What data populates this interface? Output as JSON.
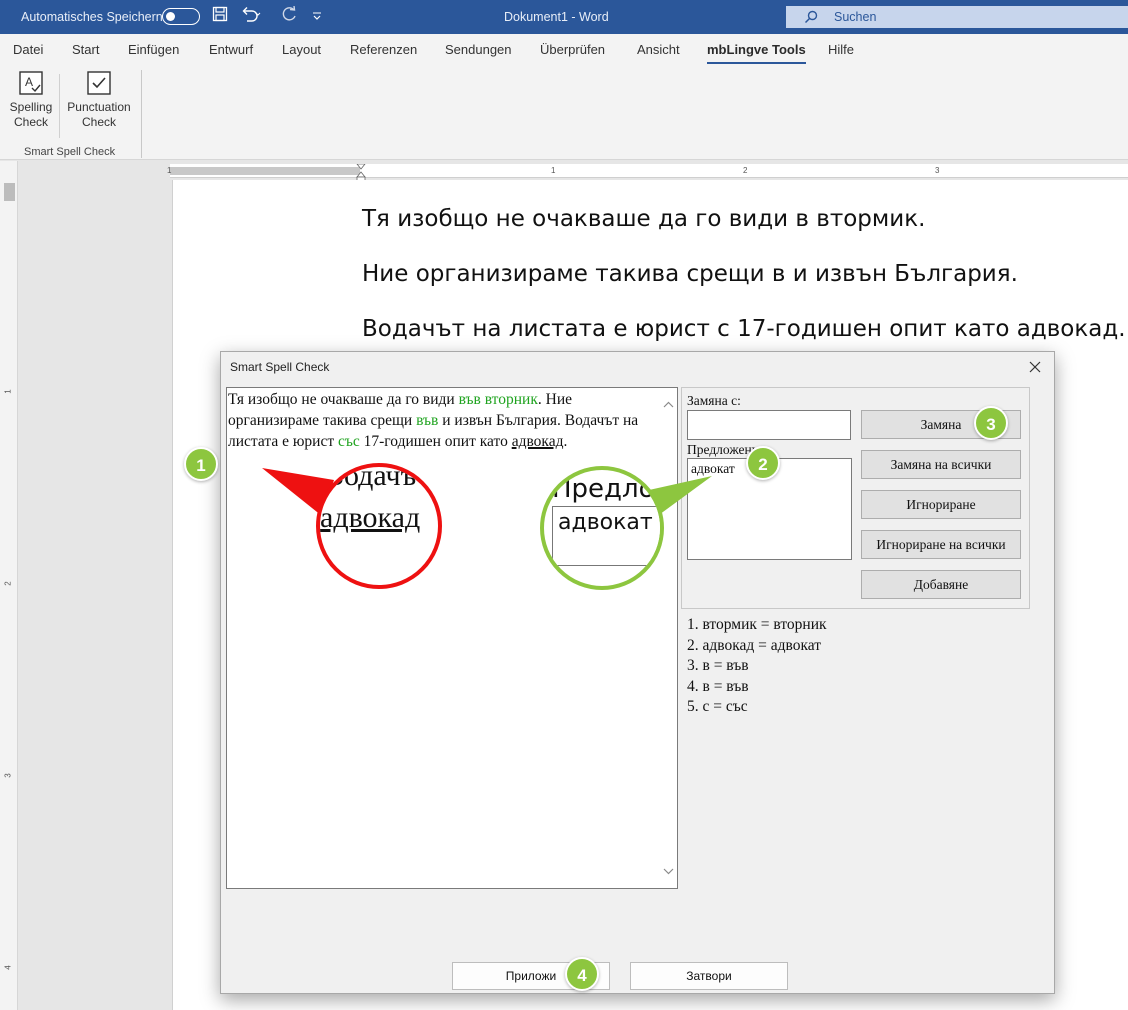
{
  "titlebar": {
    "autosave_label": "Automatisches Speichern",
    "doc_title": "Dokument1 - Word",
    "search_placeholder": "Suchen"
  },
  "tabs": [
    "Datei",
    "Start",
    "Einfügen",
    "Entwurf",
    "Layout",
    "Referenzen",
    "Sendungen",
    "Überprüfen",
    "Ansicht",
    "mbLingve Tools",
    "Hilfe"
  ],
  "ribbon": {
    "spelling": [
      "Spelling",
      "Check"
    ],
    "punctuation": [
      "Punctuation",
      "Check"
    ],
    "group_label": "Smart Spell Check"
  },
  "ruler": {
    "h_numbers": [
      "1",
      "1",
      "2",
      "3"
    ],
    "v_numbers": [
      "1",
      "2",
      "3",
      "4"
    ]
  },
  "document": {
    "lines": [
      "Тя изобщо не очакваше да го види в втормик.",
      "Ние организираме такива срещи в и извън България.",
      "Водачът на листата е юрист с 17-годишен опит като адвокад."
    ]
  },
  "dialog": {
    "title": "Smart Spell Check",
    "text": {
      "p1": "Тя изобщо не очакваше да го види ",
      "h1": "във вторник",
      "p2": ". Ние организираме такива срещи ",
      "h2": "във",
      "p3": " и извън България. Водачът на листата е юрист ",
      "h3": "със",
      "p4": " 17-годишен опит като ",
      "err": "адвокад",
      "p5": "."
    },
    "replace_label": "Замяна с:",
    "replace_value": "",
    "suggestions_label": "Предложения:",
    "suggestions": [
      "адвокат"
    ],
    "buttons": [
      "Замяна",
      "Замяна на всички",
      "Игнориране",
      "Игнориране на всички",
      "Добавяне"
    ],
    "corrections": [
      "1. втормик = вторник",
      "2. адвокад = адвокат",
      "3. в = във",
      "4. в = във",
      "5. с = със"
    ],
    "apply_button": "Приложи",
    "close_button": "Затвори"
  },
  "callouts": {
    "badges": [
      "1",
      "2",
      "3",
      "4"
    ],
    "zoom_red_line1": "Водачъ",
    "zoom_red_line2": "адвокад",
    "zoom_green_line1": "Предлож",
    "zoom_green_line2": "адвокат"
  },
  "colors": {
    "word_blue": "#2b579a",
    "highlight_green": "#1fa31f",
    "badge_green": "#8dc63f",
    "zoom_red": "#ee1111"
  }
}
